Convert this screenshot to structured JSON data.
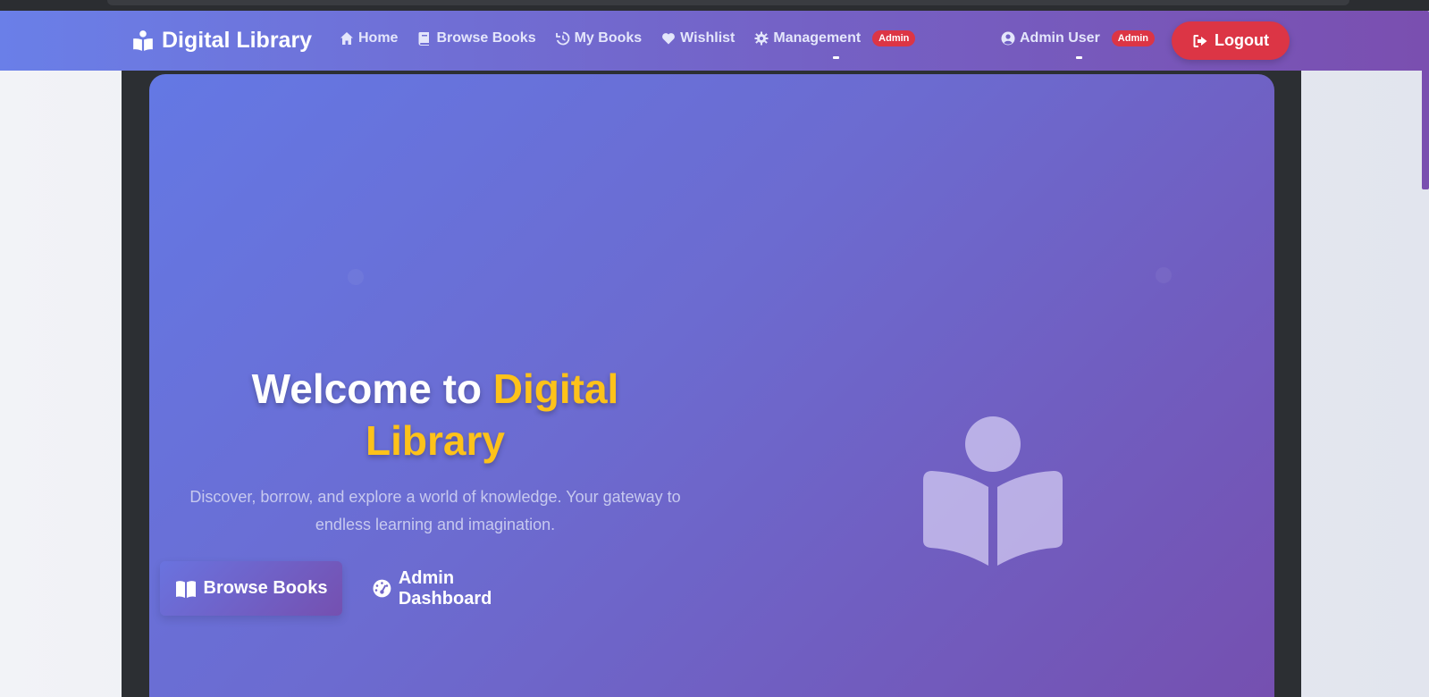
{
  "navbar": {
    "brand": "Digital Library",
    "links": [
      {
        "label": "Home",
        "icon": "home-icon"
      },
      {
        "label": "Browse Books",
        "icon": "book-icon"
      },
      {
        "label": "My Books",
        "icon": "history-icon"
      },
      {
        "label": "Wishlist",
        "icon": "heart-icon"
      },
      {
        "label": "Management",
        "icon": "gear-icon",
        "badge": "Admin"
      }
    ],
    "user": {
      "name": "Admin User",
      "badge": "Admin",
      "icon": "user-circle-icon"
    },
    "logout": "Logout"
  },
  "hero": {
    "title_prefix": "Welcome to ",
    "title_accent": "Digital",
    "title_accent_line2": "Library",
    "subtitle": "Discover, borrow, and explore a world of knowledge. Your gateway to endless learning and imagination.",
    "primary_button": "Browse Books",
    "secondary_button": "Admin Dashboard"
  },
  "colors": {
    "accent": "#fdc21a",
    "danger": "#dc3545",
    "gradient_start": "#6478e4",
    "gradient_end": "#7550b0"
  }
}
